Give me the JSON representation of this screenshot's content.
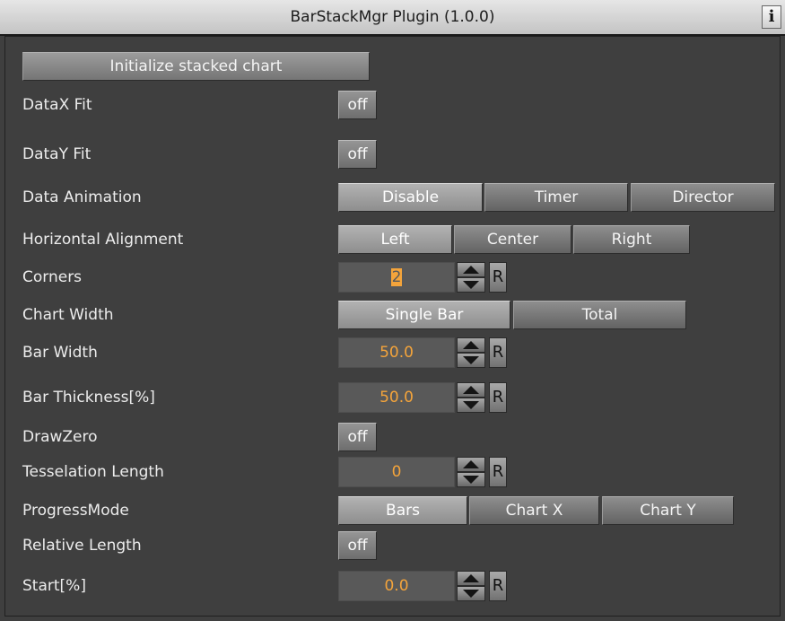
{
  "window": {
    "title": "BarStackMgr Plugin (1.0.0)",
    "info_glyph": "i"
  },
  "actions": {
    "initialize_label": "Initialize stacked chart"
  },
  "rows": {
    "datax_fit": {
      "label": "DataX Fit",
      "value": "off"
    },
    "datay_fit": {
      "label": "DataY Fit",
      "value": "off"
    },
    "data_animation": {
      "label": "Data Animation",
      "options": [
        "Disable",
        "Timer",
        "Director"
      ],
      "selected": "Disable"
    },
    "horizontal_alignment": {
      "label": "Horizontal Alignment",
      "options": [
        "Left",
        "Center",
        "Right"
      ],
      "selected": "Left"
    },
    "corners": {
      "label": "Corners",
      "value": "2",
      "reset": "R"
    },
    "chart_width": {
      "label": "Chart Width",
      "options": [
        "Single Bar",
        "Total"
      ],
      "selected": "Single Bar"
    },
    "bar_width": {
      "label": "Bar Width",
      "value": "50.0",
      "reset": "R"
    },
    "bar_thickness": {
      "label": "Bar Thickness[%]",
      "value": "50.0",
      "reset": "R"
    },
    "draw_zero": {
      "label": "DrawZero",
      "value": "off"
    },
    "tesselation_length": {
      "label": "Tesselation Length",
      "value": "0",
      "reset": "R"
    },
    "progress_mode": {
      "label": "ProgressMode",
      "options": [
        "Bars",
        "Chart X",
        "Chart Y"
      ],
      "selected": "Bars"
    },
    "relative_length": {
      "label": "Relative Length",
      "value": "off"
    },
    "start": {
      "label": "Start[%]",
      "value": "0.0",
      "reset": "R"
    }
  },
  "colors": {
    "panel_bg": "#3f3f3f",
    "value_text": "#f4a43b",
    "label_text": "#ececec"
  }
}
